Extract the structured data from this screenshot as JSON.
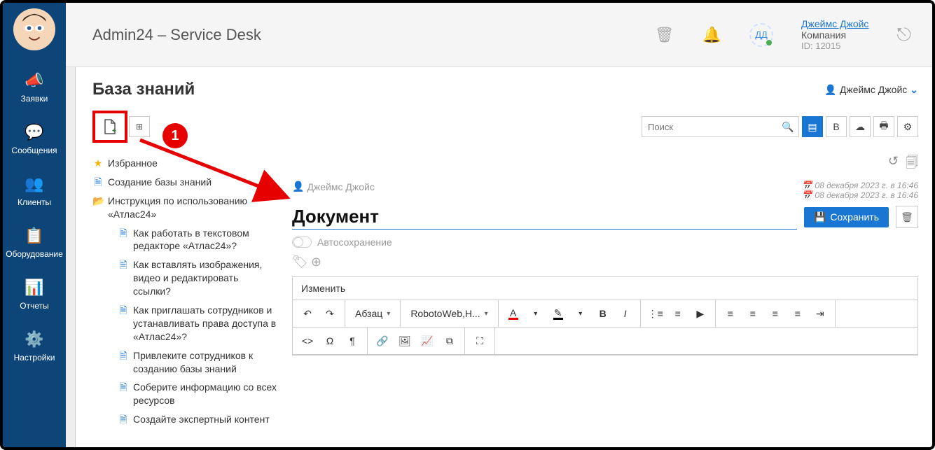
{
  "leftnav": {
    "items": [
      {
        "label": "Заявки"
      },
      {
        "label": "Сообщения"
      },
      {
        "label": "Клиенты"
      },
      {
        "label": "Оборудование"
      },
      {
        "label": "Отчеты"
      },
      {
        "label": "Настройки"
      }
    ]
  },
  "header": {
    "title": "Admin24 – Service Desk",
    "user_initials": "ДД",
    "user_name": "Джеймс Джойс",
    "company": "Компания",
    "id_label": "ID: 12015"
  },
  "page": {
    "title": "База знаний",
    "chip_user": "Джеймс Джойс",
    "search_placeholder": "Поиск"
  },
  "annotation": {
    "step1": "1"
  },
  "tree": {
    "favorites": "Избранное",
    "creating": "Создание базы знаний",
    "folder": "Инструкция по использованию «Атлас24»",
    "children": [
      "Как работать в текстовом редакторе «Атлас24»?",
      "Как вставлять изображения, видео и редактировать ссылки?",
      "Как приглашать сотрудников и устанавливать права доступа в «Атлас24»?",
      "Привлеките сотрудников к созданию базы знаний",
      "Соберите информацию со всех ресурсов",
      "Создайте экспертный контент"
    ]
  },
  "doc": {
    "author": "Джеймс Джойс",
    "created": "08 декабря 2023 г. в 16:46",
    "modified": "08 декабря 2023 г. в 16:46",
    "title": "Документ",
    "save": "Сохранить",
    "autosave": "Автосохранение",
    "rte_tab": "Изменить",
    "paragraph": "Абзац",
    "font": "RobotoWeb,H..."
  }
}
